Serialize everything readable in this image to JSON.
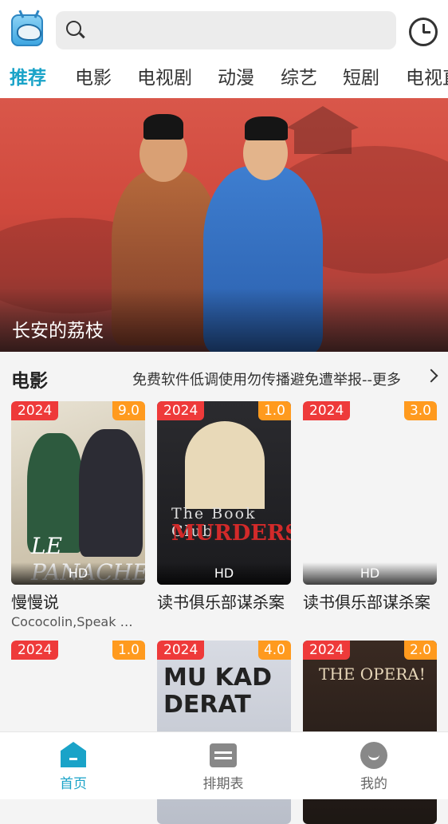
{
  "header": {
    "search_placeholder": "",
    "tabs": [
      "推荐",
      "电影",
      "电视剧",
      "动漫",
      "综艺",
      "短剧",
      "电视直播"
    ]
  },
  "banner": {
    "title": "长安的荔枝"
  },
  "section": {
    "title": "电影",
    "more": "免费软件低调使用勿传播避免遭举报--更多"
  },
  "movies": [
    {
      "year": "2024",
      "score": "9.0",
      "quality": "HD",
      "title": "慢慢说",
      "subtitle": "Cococolin,Speak …"
    },
    {
      "year": "2024",
      "score": "1.0",
      "quality": "HD",
      "title": "读书俱乐部谋杀案",
      "subtitle": ""
    },
    {
      "year": "2024",
      "score": "3.0",
      "quality": "HD",
      "title": "读书俱乐部谋杀案",
      "subtitle": ""
    },
    {
      "year": "2024",
      "score": "1.0",
      "quality": "",
      "title": "",
      "subtitle": ""
    },
    {
      "year": "2024",
      "score": "4.0",
      "quality": "",
      "title": "",
      "subtitle": ""
    },
    {
      "year": "2024",
      "score": "2.0",
      "quality": "",
      "title": "",
      "subtitle": ""
    }
  ],
  "poster_text": {
    "p1": "LE PANACHE",
    "p2_line1": "The Book Club",
    "p2_line2": "MURDERS",
    "p4": "MU KAD DERAT",
    "p5": "THE OPERA!"
  },
  "bottom_nav": [
    "首页",
    "排期表",
    "我的"
  ]
}
